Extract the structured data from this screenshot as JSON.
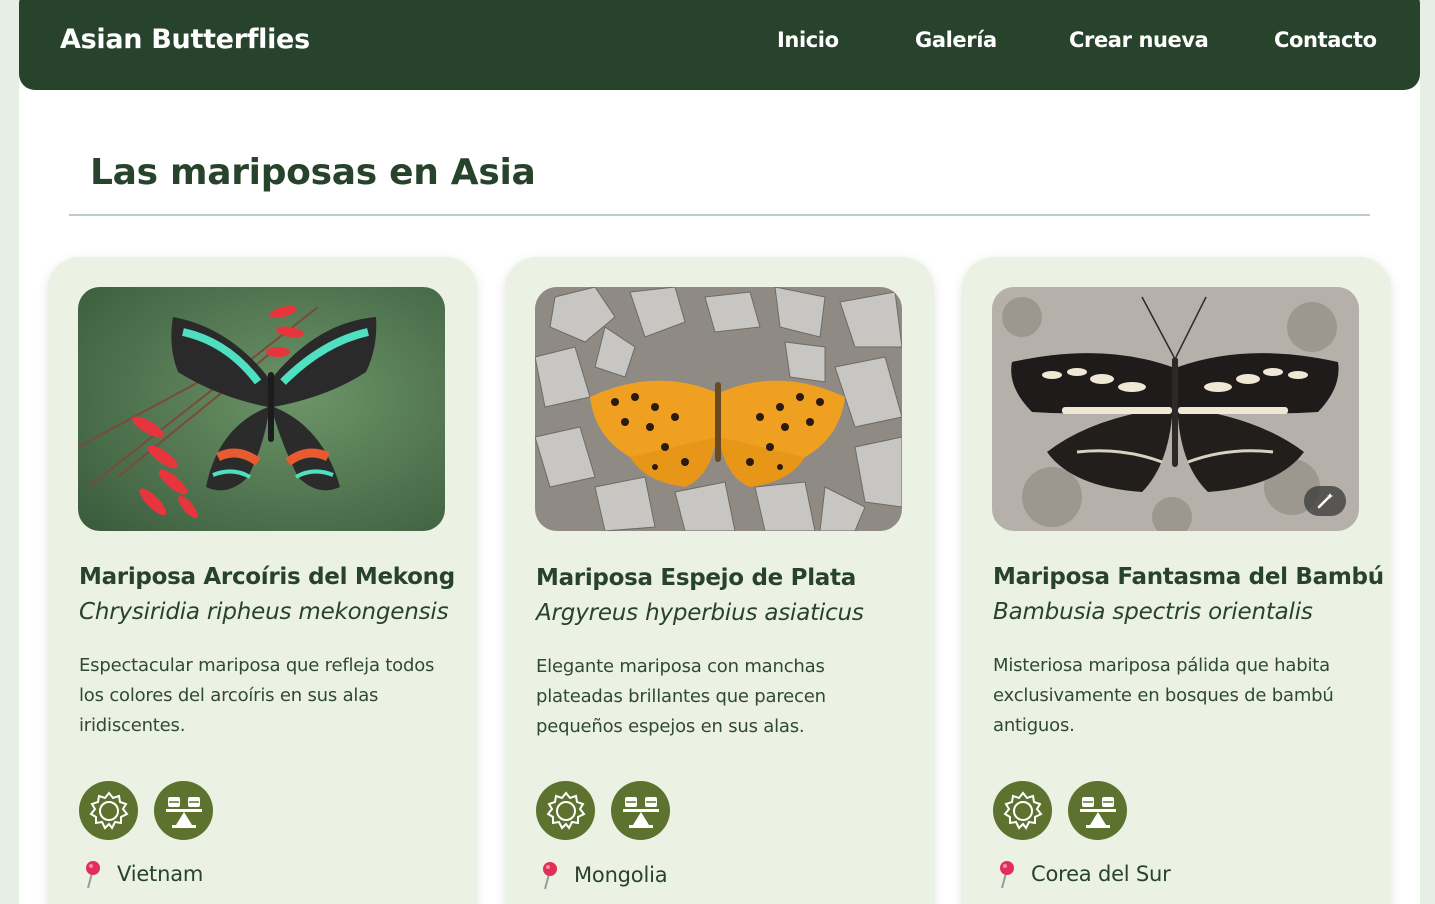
{
  "nav": {
    "brand": "Asian Butterflies",
    "links": [
      "Inicio",
      "Galería",
      "Crear nueva",
      "Contacto"
    ]
  },
  "page_title": "Las mariposas en Asia",
  "cards": [
    {
      "name": "Mariposa Arcoíris del Mekong",
      "scientific": "Chrysiridia ripheus mekongensis",
      "description": "Espectacular mariposa que refleja todos los colores del arcoíris en sus alas iridiscentes.",
      "location": "Vietnam",
      "badges": [
        "sun-icon",
        "balance-icon"
      ]
    },
    {
      "name": "Mariposa Espejo de Plata",
      "scientific": "Argyreus hyperbius asiaticus",
      "description": "Elegante mariposa con manchas plateadas brillantes que parecen pequeños espejos en sus alas.",
      "location": "Mongolia",
      "badges": [
        "sun-icon",
        "balance-icon"
      ]
    },
    {
      "name": "Mariposa Fantasma del Bambú",
      "scientific": "Bambusia spectris orientalis",
      "description": "Misteriosa mariposa pálida que habita exclusivamente en bosques de bambú antiguos.",
      "location": "Corea del Sur",
      "badges": [
        "sun-icon",
        "balance-icon"
      ]
    }
  ],
  "colors": {
    "nav_bg": "#28432c",
    "card_bg": "#ebf1e3",
    "badge_bg": "#5e722f",
    "text": "#28432c"
  }
}
